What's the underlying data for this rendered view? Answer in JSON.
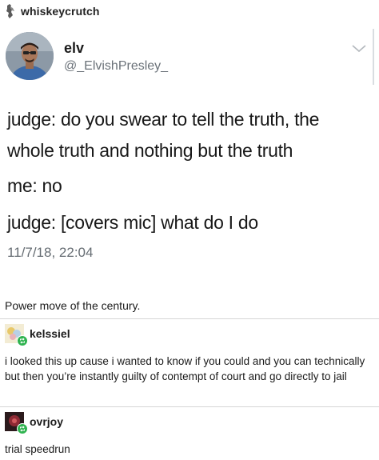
{
  "post": {
    "poster_username": "whiskeycrutch"
  },
  "tweet": {
    "display_name": "elv",
    "handle": "@_ElvishPresley_",
    "lines": [
      "judge: do you swear to tell the truth, the",
      "whole truth and nothing but the truth",
      "me: no",
      "judge: [covers mic] what do I do"
    ],
    "timestamp": "11/7/18, 22:04",
    "menu_icon": "chevron-down-icon"
  },
  "caption": "Power move of the century.",
  "replies": [
    {
      "username": "kelssiel",
      "text": "i looked this up cause i wanted to know if you could and you can technically but then you’re instantly guilty of contempt of court and go directly to jail",
      "badge_icon": "reblog-icon"
    },
    {
      "username": "ovrjoy",
      "text": "trial speedrun",
      "badge_icon": "reblog-icon"
    }
  ],
  "colors": {
    "text": "#1a1a1a",
    "muted": "#6b7279",
    "reblog_badge": "#2fb34f",
    "divider": "#d6d6d6"
  }
}
